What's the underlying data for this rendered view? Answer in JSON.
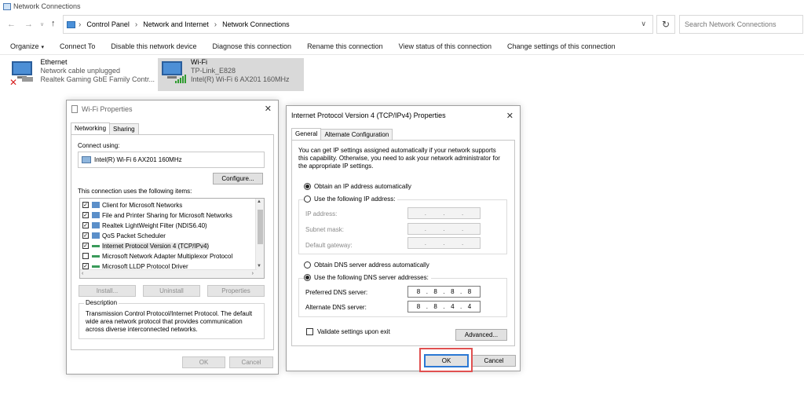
{
  "window": {
    "title": "Network Connections"
  },
  "address": {
    "crumbs": [
      "Control Panel",
      "Network and Internet",
      "Network Connections"
    ],
    "search_placeholder": "Search Network Connections"
  },
  "commands": {
    "organize": "Organize",
    "connect_to": "Connect To",
    "disable": "Disable this network device",
    "diagnose": "Diagnose this connection",
    "rename": "Rename this connection",
    "view_status": "View status of this connection",
    "change_settings": "Change settings of this connection"
  },
  "connections": [
    {
      "name": "Ethernet",
      "status": "Network cable unplugged",
      "adapter": "Realtek Gaming GbE Family Contr..."
    },
    {
      "name": "Wi-Fi",
      "status": "TP-Link_E828",
      "adapter": "Intel(R) Wi-Fi 6 AX201 160MHz"
    }
  ],
  "wifi_props": {
    "title": "Wi-Fi Properties",
    "tabs": [
      "Networking",
      "Sharing"
    ],
    "connect_using_label": "Connect using:",
    "adapter": "Intel(R) Wi-Fi 6 AX201 160MHz",
    "configure": "Configure...",
    "items_label": "This connection uses the following items:",
    "items": [
      {
        "label": "Client for Microsoft Networks",
        "checked": true
      },
      {
        "label": "File and Printer Sharing for Microsoft Networks",
        "checked": true
      },
      {
        "label": "Realtek LightWeight Filter (NDIS6.40)",
        "checked": true
      },
      {
        "label": "QoS Packet Scheduler",
        "checked": true
      },
      {
        "label": "Internet Protocol Version 4 (TCP/IPv4)",
        "checked": true
      },
      {
        "label": "Microsoft Network Adapter Multiplexor Protocol",
        "checked": false
      },
      {
        "label": "Microsoft LLDP Protocol Driver",
        "checked": true
      }
    ],
    "install": "Install...",
    "uninstall": "Uninstall",
    "properties": "Properties",
    "description_label": "Description",
    "description": "Transmission Control Protocol/Internet Protocol. The default wide area network protocol that provides communication across diverse interconnected networks.",
    "ok": "OK",
    "cancel": "Cancel"
  },
  "ipv4_props": {
    "title": "Internet Protocol Version 4 (TCP/IPv4) Properties",
    "tabs": [
      "General",
      "Alternate Configuration"
    ],
    "intro": "You can get IP settings assigned automatically if your network supports this capability. Otherwise, you need to ask your network administrator for the appropriate IP settings.",
    "obtain_ip_auto": "Obtain an IP address automatically",
    "use_following_ip": "Use the following IP address:",
    "ip_address": "IP address:",
    "subnet_mask": "Subnet mask:",
    "default_gateway": "Default gateway:",
    "obtain_dns_auto": "Obtain DNS server address automatically",
    "use_following_dns": "Use the following DNS server addresses:",
    "preferred_dns_label": "Preferred DNS server:",
    "preferred_dns": [
      "8",
      "8",
      "8",
      "8"
    ],
    "alternate_dns_label": "Alternate DNS server:",
    "alternate_dns": [
      "8",
      "8",
      "4",
      "4"
    ],
    "validate": "Validate settings upon exit",
    "advanced": "Advanced...",
    "ok": "OK",
    "cancel": "Cancel"
  }
}
